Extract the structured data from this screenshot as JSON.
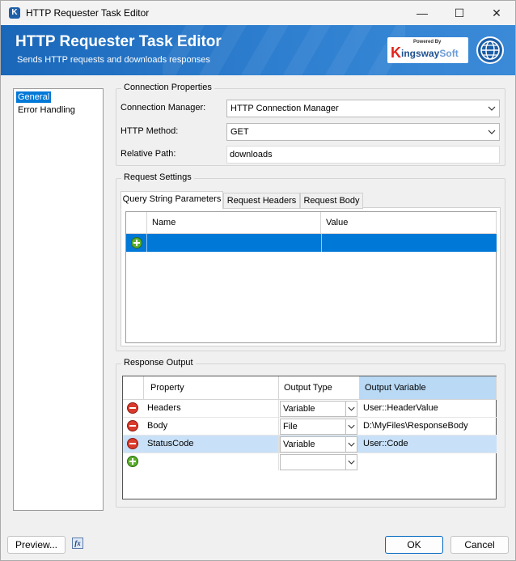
{
  "window": {
    "title": "HTTP Requester Task Editor",
    "app_icon": "K",
    "minimize_glyph": "—",
    "maximize_glyph": "☐",
    "close_glyph": "✕"
  },
  "banner": {
    "title": "HTTP Requester Task Editor",
    "subtitle": "Sends HTTP requests and downloads responses",
    "brand_powered_by": "Powered By",
    "brand_k": "K",
    "brand_name_main": "ingsway",
    "brand_name_soft": "Soft",
    "globe_icon": "globe-icon"
  },
  "nav": {
    "items": [
      {
        "label": "General",
        "selected": true
      },
      {
        "label": "Error Handling",
        "selected": false
      }
    ]
  },
  "connection": {
    "legend": "Connection Properties",
    "manager_label": "Connection Manager:",
    "manager_value": "HTTP Connection Manager",
    "method_label": "HTTP Method:",
    "method_value": "GET",
    "path_label": "Relative Path:",
    "path_value": "downloads"
  },
  "request": {
    "legend": "Request Settings",
    "tabs": [
      {
        "label": "Query String Parameters",
        "active": true
      },
      {
        "label": "Request Headers",
        "active": false
      },
      {
        "label": "Request Body",
        "active": false
      }
    ],
    "grid": {
      "columns": [
        "Name",
        "Value"
      ]
    }
  },
  "response": {
    "legend": "Response Output",
    "columns": [
      "Property",
      "Output Type",
      "Output Variable"
    ],
    "rows": [
      {
        "property": "Headers",
        "output_type": "Variable",
        "output_variable": "User::HeaderValue",
        "highlighted": false
      },
      {
        "property": "Body",
        "output_type": "File",
        "output_variable": "D:\\MyFiles\\ResponseBody",
        "highlighted": false
      },
      {
        "property": "StatusCode",
        "output_type": "Variable",
        "output_variable": "User::Code",
        "highlighted": true
      }
    ]
  },
  "footer": {
    "preview_label": "Preview...",
    "fx_label": "fx",
    "ok_label": "OK",
    "cancel_label": "Cancel"
  },
  "colors": {
    "banner": "#1a67b9",
    "selection": "#0078d7",
    "row_highlight": "#c9e1f8",
    "header_selected": "#b9d9f5"
  }
}
